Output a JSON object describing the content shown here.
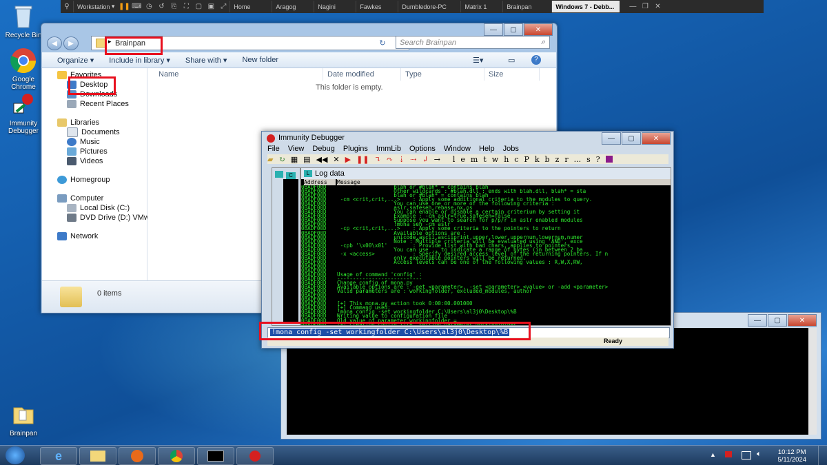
{
  "vmware": {
    "workstation_label": "Workstation",
    "tabs": [
      "Home",
      "Aragog",
      "Nagini",
      "Fawkes",
      "Dumbledore-PC",
      "Matrix 1",
      "Brainpan",
      "Windows 7 - Debb..."
    ]
  },
  "desktop": {
    "icons": [
      {
        "label": "Recycle Bin",
        "icon": "recycle-bin-icon"
      },
      {
        "label": "Google Chrome",
        "icon": "chrome-icon"
      },
      {
        "label": "Immunity Debugger",
        "icon": "immunity-debugger-icon"
      },
      {
        "label": "Brainpan",
        "icon": "brainpan-folder-icon"
      }
    ]
  },
  "explorer": {
    "address": "Brainpan",
    "search_placeholder": "Search Brainpan",
    "toolbar": {
      "organize": "Organize ▾",
      "include": "Include in library ▾",
      "share": "Share with ▾",
      "new_folder": "New folder"
    },
    "nav": {
      "favorites": "Favorites",
      "desktop": "Desktop",
      "downloads": "Downloads",
      "recent": "Recent Places",
      "libraries": "Libraries",
      "documents": "Documents",
      "music": "Music",
      "pictures": "Pictures",
      "videos": "Videos",
      "homegroup": "Homegroup",
      "computer": "Computer",
      "local_disk": "Local Disk (C:)",
      "dvd": "DVD Drive (D:) VMw",
      "network": "Network"
    },
    "columns": {
      "name": "Name",
      "date": "Date modified",
      "type": "Type",
      "size": "Size"
    },
    "empty_text": "This folder is empty.",
    "items_count": "0 items"
  },
  "immunity": {
    "title": "Immunity Debugger",
    "menu": [
      "File",
      "View",
      "Debug",
      "Plugins",
      "ImmLib",
      "Options",
      "Window",
      "Help",
      "Jobs"
    ],
    "tool_letters": [
      "l",
      "e",
      "m",
      "t",
      "w",
      "h",
      "c",
      "P",
      "k",
      "b",
      "z",
      "r",
      "...",
      "s",
      "?"
    ],
    "log_title": "Log data",
    "col_address": "Address",
    "col_message": "Message",
    "log_rows": [
      {
        "addr": "0BADF00D",
        "msg": "                  blah or #blah* = contains blah"
      },
      {
        "addr": "0BADF00D",
        "msg": "                  Other wildcards : #blah.dll : ends with blah.dll, blah* = sta"
      },
      {
        "addr": "0BADF00D",
        "msg": "                  blah or #blah* = contains blah"
      },
      {
        "addr": "0BADF00D",
        "msg": " -cm <crit,crit,...>    : Apply some additional criteria to the modules to query."
      },
      {
        "addr": "0BADF00D",
        "msg": "                  You can use one or more of the following criteria :"
      },
      {
        "addr": "0BADF00D",
        "msg": "                  aslr,safeseh,rebase,nx,os"
      },
      {
        "addr": "0BADF00D",
        "msg": "                  You can enable or disable a certain criterium by setting it"
      },
      {
        "addr": "0BADF00D",
        "msg": "                  Example : -cm aslr=true,safeseh=false"
      },
      {
        "addr": "0BADF00D",
        "msg": "                  Suppose you want to search for p/p/r in aslr enabled modules"
      },
      {
        "addr": "0BADF00D",
        "msg": "                  !mona seh -cm aslr"
      },
      {
        "addr": "0BADF00D",
        "msg": " -cp <crit,crit,...>    : Apply some criteria to the pointers to return"
      },
      {
        "addr": "0BADF00D",
        "msg": "                  Available options are :"
      },
      {
        "addr": "0BADF00D",
        "msg": "                  unicode,ascii,asciiprint,upper,lower,uppernum,lowernum,numer"
      },
      {
        "addr": "0BADF00D",
        "msg": "                  Note : Multiple criteria will be evaluated using 'AND', exce"
      },
      {
        "addr": "0BADF00D",
        "msg": " -cpb '\\x00\\x01'        : Provide list with bad chars, applies to pointers"
      },
      {
        "addr": "0BADF00D",
        "msg": "                  You can use .. to indicate a range of bytes (in between 2 ba"
      },
      {
        "addr": "0BADF00D",
        "msg": " -x <access>            : Specify desired access level of the returning pointers. If n"
      },
      {
        "addr": "0BADF00D",
        "msg": "                  only executable pointers will be returned."
      },
      {
        "addr": "0BADF00D",
        "msg": "                  Access levels can be one of the following values : R,W,X,RW,"
      },
      {
        "addr": "0BADF00D",
        "msg": ""
      },
      {
        "addr": "0BADF00D",
        "msg": ""
      },
      {
        "addr": "0BADF00D",
        "msg": "Usage of command 'config' :"
      },
      {
        "addr": "0BADF00D",
        "msg": "---------------------------"
      },
      {
        "addr": "0BADF00D",
        "msg": "Change config of mona.py"
      },
      {
        "addr": "0BADF00D",
        "msg": "Available options are : -get <parameter>, -set <parameter> <value> or -add <parameter>"
      },
      {
        "addr": "0BADF00D",
        "msg": "Valid parameters are : workingfolder, excluded_modules, author"
      },
      {
        "addr": "0BADF00D",
        "msg": ""
      },
      {
        "addr": "0BADF00D",
        "msg": ""
      },
      {
        "addr": "0BADF00D",
        "msg": "[+] This mona.py action took 0:00:00.001000"
      },
      {
        "addr": "0BADF00D",
        "msg": "[+] Command used:"
      },
      {
        "addr": "0BADF00D",
        "msg": "!mona config -set workingfolder C:\\Users\\al3j0\\Desktop\\%B"
      },
      {
        "addr": "0BADF00D",
        "msg": "Writing value to configuration file"
      },
      {
        "addr": "0BADF00D",
        "msg": "Old value of parameter workingfolder ="
      },
      {
        "addr": "0BADF00D",
        "msg": "[+] Creating config file, setting parameter workingfolder"
      },
      {
        "addr": "0BADF00D",
        "msg": "New value of parameter workingfolder =  C:\\Users\\al3j0\\Desktop\\%B"
      }
    ],
    "command": "!mona config -set workingfolder C:\\Users\\al3j0\\Desktop\\%B",
    "status": "Ready"
  },
  "taskbar": {
    "time": "10:12 PM",
    "date": "5/11/2024"
  },
  "colors": {
    "highlight": "#e8101e",
    "log_green": "#2ee82e"
  }
}
